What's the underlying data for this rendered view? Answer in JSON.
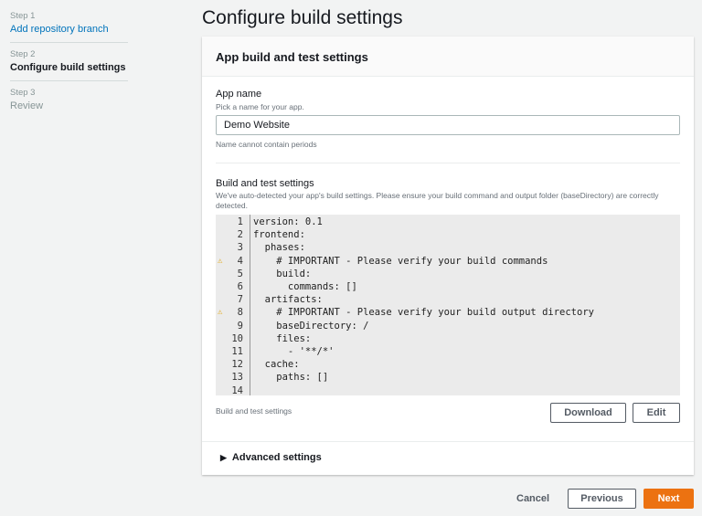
{
  "sidebar": {
    "steps": [
      {
        "label": "Step 1",
        "title": "Add repository branch"
      },
      {
        "label": "Step 2",
        "title": "Configure build settings"
      },
      {
        "label": "Step 3",
        "title": "Review"
      }
    ]
  },
  "page_title": "Configure build settings",
  "panel": {
    "header": "App build and test settings",
    "app_name": {
      "label": "App name",
      "description": "Pick a name for your app.",
      "value": "Demo Website",
      "constraint": "Name cannot contain periods"
    },
    "build": {
      "label": "Build and test settings",
      "description": "We've auto-detected your app's build settings. Please ensure your build command and output folder (baseDirectory) are correctly detected.",
      "lines": [
        {
          "n": "1",
          "text": "version: 0.1",
          "warn": false
        },
        {
          "n": "2",
          "text": "frontend:",
          "warn": false
        },
        {
          "n": "3",
          "text": "  phases:",
          "warn": false
        },
        {
          "n": "4",
          "text": "    # IMPORTANT - Please verify your build commands",
          "warn": true
        },
        {
          "n": "5",
          "text": "    build:",
          "warn": false
        },
        {
          "n": "6",
          "text": "      commands: []",
          "warn": false
        },
        {
          "n": "7",
          "text": "  artifacts:",
          "warn": false
        },
        {
          "n": "8",
          "text": "    # IMPORTANT - Please verify your build output directory",
          "warn": true
        },
        {
          "n": "9",
          "text": "    baseDirectory: /",
          "warn": false
        },
        {
          "n": "10",
          "text": "    files:",
          "warn": false
        },
        {
          "n": "11",
          "text": "      - '**/*'",
          "warn": false
        },
        {
          "n": "12",
          "text": "  cache:",
          "warn": false
        },
        {
          "n": "13",
          "text": "    paths: []",
          "warn": false
        },
        {
          "n": "14",
          "text": "",
          "warn": false
        }
      ],
      "footer_label": "Build and test settings",
      "download": "Download",
      "edit": "Edit"
    },
    "advanced": "Advanced settings"
  },
  "footer": {
    "cancel": "Cancel",
    "previous": "Previous",
    "next": "Next"
  },
  "colors": {
    "accent": "#ec7211",
    "link": "#0073bb"
  }
}
